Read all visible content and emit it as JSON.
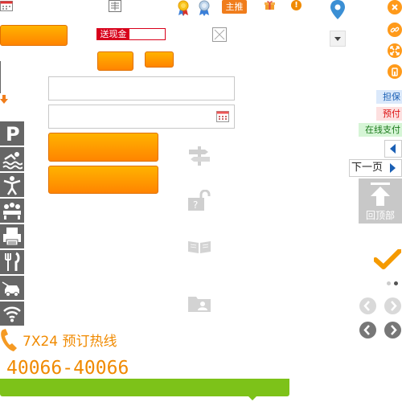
{
  "promo": {
    "cash_label": "送现金",
    "recommend_label": "主推"
  },
  "sidebar_tags": {
    "guarantee": "担保",
    "prepay": "预付",
    "online_pay": "在线支付"
  },
  "pager": {
    "next_label": "下一页"
  },
  "back_to_top": {
    "label": "回顶部"
  },
  "hotline": {
    "label": "7X24 预订热线",
    "number": "40066-40066"
  },
  "amenities": [
    "parking",
    "swimming",
    "fitness",
    "meeting-room",
    "business-center",
    "restaurant",
    "car-rental",
    "wifi"
  ],
  "colors": {
    "accent": "#ff8a00",
    "recommend_badge": "#f07d1c",
    "cash_badge": "#d8001b",
    "bar_green": "#7dc219",
    "tag_guarantee_bg": "#dbe9fb",
    "tag_prepay_bg": "#fde0e0",
    "tag_online_bg": "#d6f5d6",
    "icon_gray": "#666666"
  }
}
